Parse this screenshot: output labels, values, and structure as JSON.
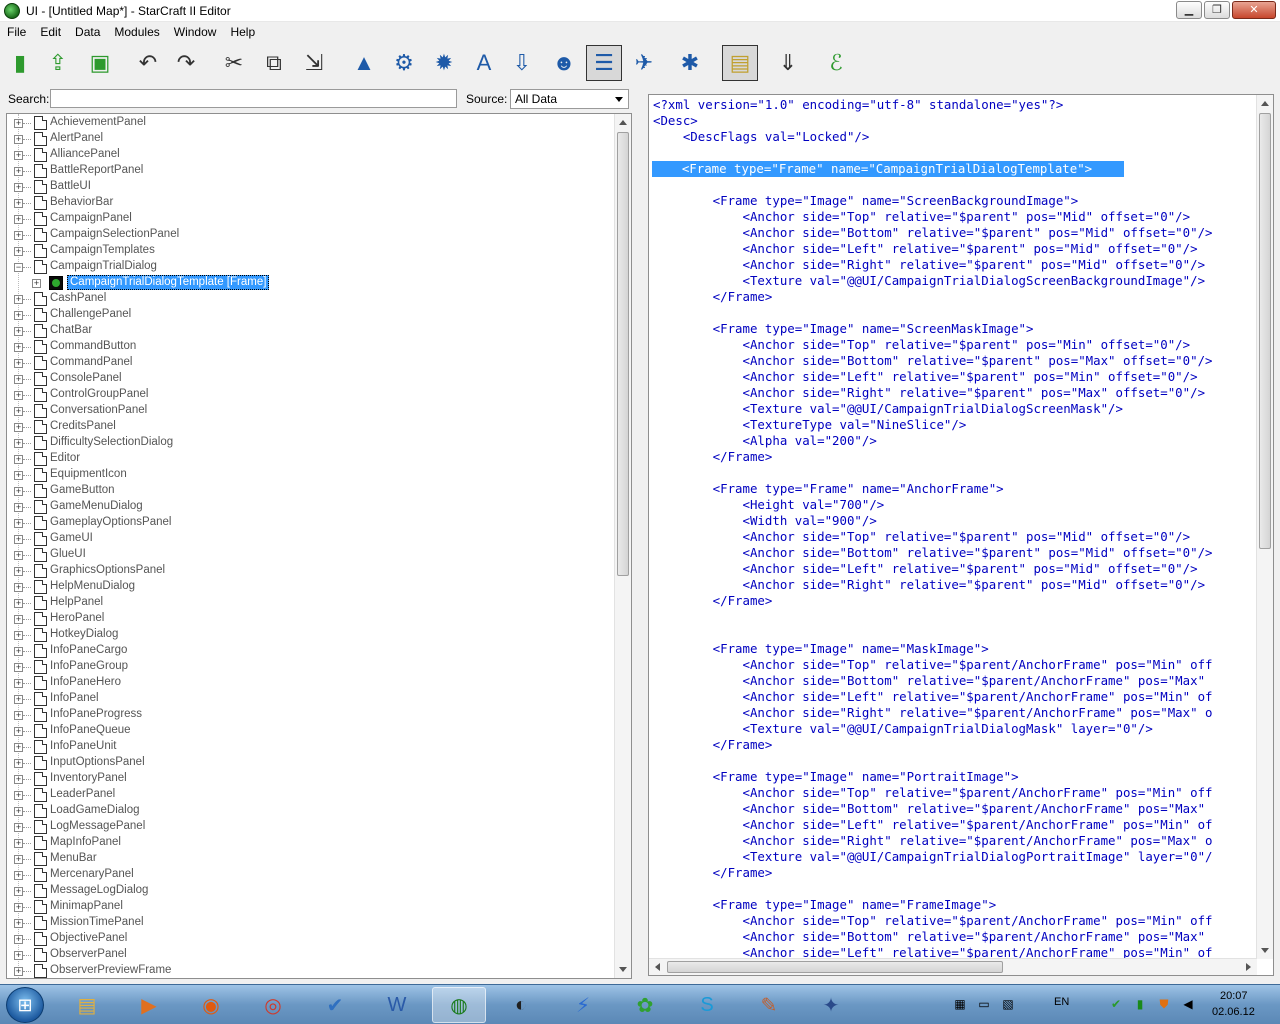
{
  "window": {
    "title": "UI - [Untitled Map*] - StarCraft II Editor",
    "minimize_label": "▁",
    "maximize_label": "❐",
    "close_label": "✕"
  },
  "menu": [
    "File",
    "Edit",
    "Data",
    "Modules",
    "Window",
    "Help"
  ],
  "toolbar": {
    "buttons": [
      {
        "name": "new-document-icon",
        "glyph": "▮",
        "color": "#2e9a2e"
      },
      {
        "name": "open-document-icon",
        "glyph": "⇪",
        "color": "#2e9a2e"
      },
      {
        "name": "save-icon",
        "glyph": "▣",
        "color": "#2e9a2e"
      },
      {
        "name": "undo-icon",
        "glyph": "↶",
        "color": "#333333"
      },
      {
        "name": "redo-icon",
        "glyph": "↷",
        "color": "#333333"
      },
      {
        "name": "cut-icon",
        "glyph": "✂",
        "color": "#333333"
      },
      {
        "name": "copy-icon",
        "glyph": "⧉",
        "color": "#333333"
      },
      {
        "name": "paste-icon",
        "glyph": "⇲",
        "color": "#333333"
      },
      {
        "name": "terrain-module-icon",
        "glyph": "▲",
        "color": "#1e5aa8"
      },
      {
        "name": "trigger-module-icon",
        "glyph": "⚙",
        "color": "#1e5aa8"
      },
      {
        "name": "data-module-icon",
        "glyph": "✹",
        "color": "#1e5aa8"
      },
      {
        "name": "text-module-icon",
        "glyph": "A",
        "color": "#1e5aa8"
      },
      {
        "name": "import-module-icon",
        "glyph": "⇩",
        "color": "#1e5aa8"
      },
      {
        "name": "ai-module-icon",
        "glyph": "☻",
        "color": "#1e5aa8"
      },
      {
        "name": "ui-module-icon",
        "glyph": "☰",
        "color": "#1e5aa8"
      },
      {
        "name": "cutscene-module-icon",
        "glyph": "✈",
        "color": "#1e5aa8"
      },
      {
        "name": "previewer-module-icon",
        "glyph": "✱",
        "color": "#1e5aa8"
      },
      {
        "name": "script-icon",
        "glyph": "▤",
        "color": "#c0a030"
      },
      {
        "name": "xml-export-icon",
        "glyph": "⇓",
        "color": "#333333"
      },
      {
        "name": "test-map-icon",
        "glyph": "ℰ",
        "color": "#2e9a2e"
      }
    ]
  },
  "search": {
    "label": "Search:",
    "value": "",
    "placeholder": ""
  },
  "source": {
    "label": "Source:",
    "value": "All Data"
  },
  "tree": {
    "items_before": [
      "AchievementPanel",
      "AlertPanel",
      "AlliancePanel",
      "BattleReportPanel",
      "BattleUI",
      "BehaviorBar",
      "CampaignPanel",
      "CampaignSelectionPanel",
      "CampaignTemplates",
      "CampaignTrialDialog"
    ],
    "expanded_item": "CampaignTrialDialog",
    "selected_child": "CampaignTrialDialogTemplate [Frame]",
    "items_after": [
      "CashPanel",
      "ChallengePanel",
      "ChatBar",
      "CommandButton",
      "CommandPanel",
      "ConsolePanel",
      "ControlGroupPanel",
      "ConversationPanel",
      "CreditsPanel",
      "DifficultySelectionDialog",
      "Editor",
      "EquipmentIcon",
      "GameButton",
      "GameMenuDialog",
      "GameplayOptionsPanel",
      "GameUI",
      "GlueUI",
      "GraphicsOptionsPanel",
      "HelpMenuDialog",
      "HelpPanel",
      "HeroPanel",
      "HotkeyDialog",
      "InfoPaneCargo",
      "InfoPaneGroup",
      "InfoPaneHero",
      "InfoPanel",
      "InfoPaneProgress",
      "InfoPaneQueue",
      "InfoPaneUnit",
      "InputOptionsPanel",
      "InventoryPanel",
      "LeaderPanel",
      "LoadGameDialog",
      "LogMessagePanel",
      "MapInfoPanel",
      "MenuBar",
      "MercenaryPanel",
      "MessageLogDialog",
      "MinimapPanel",
      "MissionTimePanel",
      "ObjectivePanel",
      "ObserverPanel",
      "ObserverPreviewFrame"
    ]
  },
  "xml": {
    "selected_line_index": 4,
    "lines": [
      "<?xml version=\"1.0\" encoding=\"utf-8\" standalone=\"yes\"?>",
      "<Desc>",
      "    <DescFlags val=\"Locked\"/>",
      "",
      "    <Frame type=\"Frame\" name=\"CampaignTrialDialogTemplate\">",
      "",
      "        <Frame type=\"Image\" name=\"ScreenBackgroundImage\">",
      "            <Anchor side=\"Top\" relative=\"$parent\" pos=\"Mid\" offset=\"0\"/>",
      "            <Anchor side=\"Bottom\" relative=\"$parent\" pos=\"Mid\" offset=\"0\"/>",
      "            <Anchor side=\"Left\" relative=\"$parent\" pos=\"Mid\" offset=\"0\"/>",
      "            <Anchor side=\"Right\" relative=\"$parent\" pos=\"Mid\" offset=\"0\"/>",
      "            <Texture val=\"@@UI/CampaignTrialDialogScreenBackgroundImage\"/>",
      "        </Frame>",
      "",
      "        <Frame type=\"Image\" name=\"ScreenMaskImage\">",
      "            <Anchor side=\"Top\" relative=\"$parent\" pos=\"Min\" offset=\"0\"/>",
      "            <Anchor side=\"Bottom\" relative=\"$parent\" pos=\"Max\" offset=\"0\"/>",
      "            <Anchor side=\"Left\" relative=\"$parent\" pos=\"Min\" offset=\"0\"/>",
      "            <Anchor side=\"Right\" relative=\"$parent\" pos=\"Max\" offset=\"0\"/>",
      "            <Texture val=\"@@UI/CampaignTrialDialogScreenMask\"/>",
      "            <TextureType val=\"NineSlice\"/>",
      "            <Alpha val=\"200\"/>",
      "        </Frame>",
      "",
      "        <Frame type=\"Frame\" name=\"AnchorFrame\">",
      "            <Height val=\"700\"/>",
      "            <Width val=\"900\"/>",
      "            <Anchor side=\"Top\" relative=\"$parent\" pos=\"Mid\" offset=\"0\"/>",
      "            <Anchor side=\"Bottom\" relative=\"$parent\" pos=\"Mid\" offset=\"0\"/>",
      "            <Anchor side=\"Left\" relative=\"$parent\" pos=\"Mid\" offset=\"0\"/>",
      "            <Anchor side=\"Right\" relative=\"$parent\" pos=\"Mid\" offset=\"0\"/>",
      "        </Frame>",
      "",
      "",
      "        <Frame type=\"Image\" name=\"MaskImage\">",
      "            <Anchor side=\"Top\" relative=\"$parent/AnchorFrame\" pos=\"Min\" off",
      "            <Anchor side=\"Bottom\" relative=\"$parent/AnchorFrame\" pos=\"Max\" ",
      "            <Anchor side=\"Left\" relative=\"$parent/AnchorFrame\" pos=\"Min\" of",
      "            <Anchor side=\"Right\" relative=\"$parent/AnchorFrame\" pos=\"Max\" o",
      "            <Texture val=\"@@UI/CampaignTrialDialogMask\" layer=\"0\"/>",
      "        </Frame>",
      "",
      "        <Frame type=\"Image\" name=\"PortraitImage\">",
      "            <Anchor side=\"Top\" relative=\"$parent/AnchorFrame\" pos=\"Min\" off",
      "            <Anchor side=\"Bottom\" relative=\"$parent/AnchorFrame\" pos=\"Max\" ",
      "            <Anchor side=\"Left\" relative=\"$parent/AnchorFrame\" pos=\"Min\" of",
      "            <Anchor side=\"Right\" relative=\"$parent/AnchorFrame\" pos=\"Max\" o",
      "            <Texture val=\"@@UI/CampaignTrialDialogPortraitImage\" layer=\"0\"/",
      "        </Frame>",
      "",
      "        <Frame type=\"Image\" name=\"FrameImage\">",
      "            <Anchor side=\"Top\" relative=\"$parent/AnchorFrame\" pos=\"Min\" off",
      "            <Anchor side=\"Bottom\" relative=\"$parent/AnchorFrame\" pos=\"Max\" ",
      "            <Anchor side=\"Left\" relative=\"$parent/AnchorFrame\" pos=\"Min\" of"
    ]
  },
  "taskbar": {
    "apps": [
      {
        "name": "explorer-icon",
        "glyph": "▤",
        "color": "#e0b040"
      },
      {
        "name": "media-player-icon",
        "glyph": "▶",
        "color": "#e07020"
      },
      {
        "name": "firefox-icon",
        "glyph": "◉",
        "color": "#e05a10"
      },
      {
        "name": "chrome-icon",
        "glyph": "◎",
        "color": "#d03a2a"
      },
      {
        "name": "windows-security-icon",
        "glyph": "✔",
        "color": "#3070c0"
      },
      {
        "name": "word-icon",
        "glyph": "W",
        "color": "#2a5aa8"
      },
      {
        "name": "starcraft-editor-icon",
        "glyph": "◍",
        "color": "#1a7a1a"
      },
      {
        "name": "steam-icon",
        "glyph": "◐",
        "color": "#202020"
      },
      {
        "name": "battlenet-icon",
        "glyph": "⚡",
        "color": "#2a6ad0"
      },
      {
        "name": "icq-icon",
        "glyph": "✿",
        "color": "#30a030"
      },
      {
        "name": "skype-icon",
        "glyph": "S",
        "color": "#1a9ad8"
      },
      {
        "name": "paint-icon",
        "glyph": "✎",
        "color": "#c06030"
      },
      {
        "name": "starcraft-icon",
        "glyph": "✦",
        "color": "#2a4a8a"
      }
    ],
    "language": "EN",
    "time": "20:07",
    "date": "02.06.12"
  }
}
